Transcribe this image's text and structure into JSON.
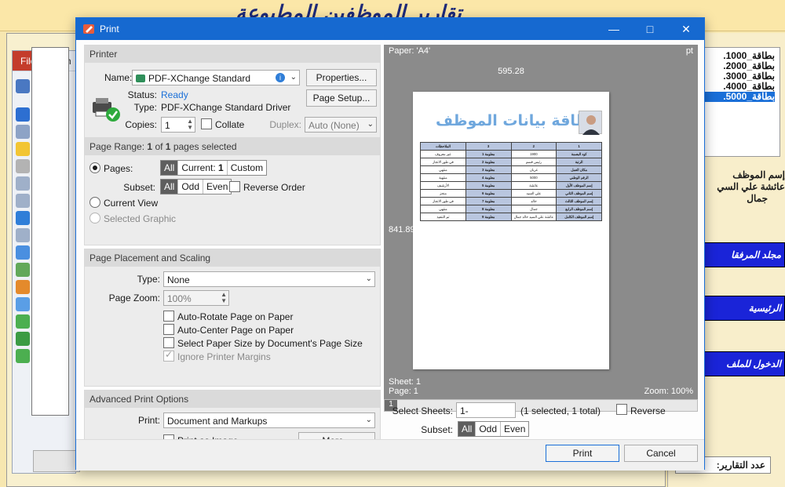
{
  "background": {
    "title": "تقارير الموظفين المطبوعة",
    "reader_tabs": [
      "File",
      "Hom"
    ],
    "cards": [
      "بطاقة_1000.",
      "بطاقة_2000.",
      "بطاقة_3000.",
      "بطاقة_4000.",
      "بطاقة_5000."
    ],
    "selected_card_index": 4,
    "employee_label": "إسم الموظف",
    "employee_name_line1": "عائشة علي السي",
    "employee_name_line2": "جمال",
    "btn_folder": "مجلد المرفقا",
    "btn_home": "الرئيسية",
    "btn_enter": "الدخول للملف",
    "reports_count_label": "عدد التقارير:"
  },
  "dialog": {
    "title": "Print",
    "printer": {
      "section": "Printer",
      "name_label": "Name:",
      "name_value": "PDF-XChange Standard",
      "properties_btn": "Properties...",
      "page_setup_btn": "Page Setup...",
      "status_label": "Status:",
      "status_value": "Ready",
      "type_label": "Type:",
      "type_value": "PDF-XChange Standard Driver",
      "copies_label": "Copies:",
      "copies_value": "1",
      "collate_label": "Collate",
      "duplex_label": "Duplex:",
      "duplex_value": "Auto (None)"
    },
    "range": {
      "section_prefix": "Page Range:",
      "count_sel": "1",
      "of": "of",
      "count_total": "1",
      "section_suffix": "pages selected",
      "pages_label": "Pages:",
      "pages_all": "All",
      "pages_current_prefix": "Current:",
      "pages_current_num": "1",
      "pages_custom": "Custom",
      "subset_label": "Subset:",
      "subset_all": "All",
      "subset_odd": "Odd",
      "subset_even": "Even",
      "reverse_order": "Reverse Order",
      "current_view": "Current View",
      "selected_graphic": "Selected Graphic"
    },
    "placement": {
      "section": "Page Placement and Scaling",
      "type_label": "Type:",
      "type_value": "None",
      "zoom_label": "Page Zoom:",
      "zoom_value": "100%",
      "auto_rotate": "Auto-Rotate Page on Paper",
      "auto_center": "Auto-Center Page on Paper",
      "select_paper": "Select Paper Size by Document's Page Size",
      "ignore_margins": "Ignore Printer Margins"
    },
    "advanced": {
      "section": "Advanced Print Options",
      "print_label": "Print:",
      "print_value": "Document and Markups",
      "print_as_image": "Print as Image",
      "more_btn": "More..."
    },
    "preview": {
      "paper": "Paper: 'A4'",
      "unit": "pt",
      "width": "595.28",
      "height": "841.89",
      "sheet": "Sheet: 1",
      "page": "Page: 1",
      "zoom": "Zoom: 100%",
      "page_num": "1",
      "card_title": "بطاقة بيانات الموظف",
      "table_header": [
        "الملاحظات",
        "3",
        "2",
        "1"
      ],
      "table_rows": [
        [
          "الملاحظات",
          "",
          "",
          ""
        ],
        [
          "غير معروف",
          "معلومة 1",
          "1900",
          "كود البصمة"
        ],
        [
          "في طور الانجاز",
          "معلومة 2",
          "رئيس قسم",
          "الرتبة"
        ],
        [
          "منتهي",
          "معلومة 3",
          "غريان",
          "مكان العمل"
        ],
        [
          "منتهية",
          "معلومة 4",
          "5000",
          "الرقم الوطني"
        ],
        [
          "الأرشيف",
          "معلومة 5",
          "عائشة",
          "إسم الموظف الأول"
        ],
        [
          "منجز",
          "معلومة 6",
          "علي السيد",
          "إسم الموظف الثاني"
        ],
        [
          "في طور الانجاز",
          "معلومة 7",
          "خالد",
          "إسم الموظف الثالث"
        ],
        [
          "منتهي",
          "معلومة 8",
          "جمال",
          "إسم الموظف الرابع"
        ],
        [
          "تم التنفيذ",
          "معلومة 9",
          "عائشة علي السيد خالد جمال",
          "إسم الموظف الكامل"
        ]
      ]
    },
    "sheets": {
      "label": "Select Sheets:",
      "value": "1-",
      "info": "(1 selected, 1 total)",
      "reverse": "Reverse",
      "subset_label": "Subset:",
      "subset_all": "All",
      "subset_odd": "Odd",
      "subset_even": "Even"
    },
    "print_btn": "Print",
    "cancel_btn": "Cancel"
  },
  "colors": {
    "titlebar": "#1669d0",
    "accent_blue": "#1a24d8",
    "status_ready": "#1a6fd8"
  }
}
